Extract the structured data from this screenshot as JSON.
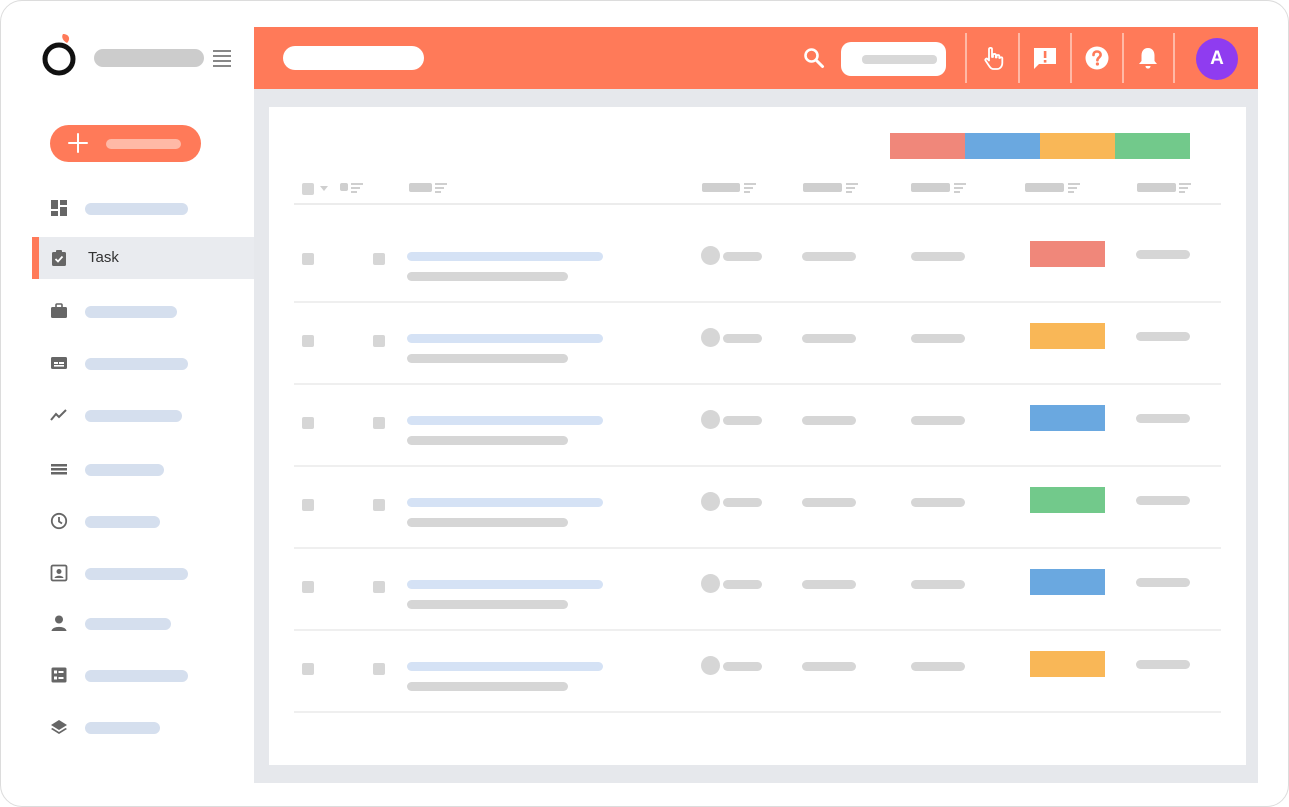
{
  "sidebar": {
    "items": [
      {
        "icon": "dashboard-icon",
        "active": false,
        "label": ""
      },
      {
        "icon": "task-clipboard-icon",
        "active": true,
        "label": "Task"
      },
      {
        "icon": "briefcase-icon",
        "active": false,
        "label": ""
      },
      {
        "icon": "id-card-icon",
        "active": false,
        "label": ""
      },
      {
        "icon": "trend-line-icon",
        "active": false,
        "label": ""
      },
      {
        "icon": "list-icon",
        "active": false,
        "label": ""
      },
      {
        "icon": "clock-icon",
        "active": false,
        "label": ""
      },
      {
        "icon": "contact-card-icon",
        "active": false,
        "label": ""
      },
      {
        "icon": "person-icon",
        "active": false,
        "label": ""
      },
      {
        "icon": "form-icon",
        "active": false,
        "label": ""
      },
      {
        "icon": "layers-icon",
        "active": false,
        "label": ""
      }
    ]
  },
  "topbar": {
    "icons": [
      "search-icon",
      "hand-pointer-icon",
      "feedback-icon",
      "help-icon",
      "bell-icon"
    ],
    "avatar_initial": "A"
  },
  "colors": {
    "accent": "#ff7a59",
    "avatar": "#8f3cf0",
    "status_red": "#f0877a",
    "status_blue": "#6aa8e0",
    "status_yellow": "#f9b757",
    "status_green": "#72c98b"
  },
  "legend": [
    "#f0877a",
    "#6aa8e0",
    "#f9b757",
    "#72c98b"
  ],
  "table": {
    "rows": [
      {
        "status_color": "#f0877a"
      },
      {
        "status_color": "#f9b757"
      },
      {
        "status_color": "#6aa8e0"
      },
      {
        "status_color": "#72c98b"
      },
      {
        "status_color": "#6aa8e0"
      },
      {
        "status_color": "#f9b757"
      }
    ]
  }
}
